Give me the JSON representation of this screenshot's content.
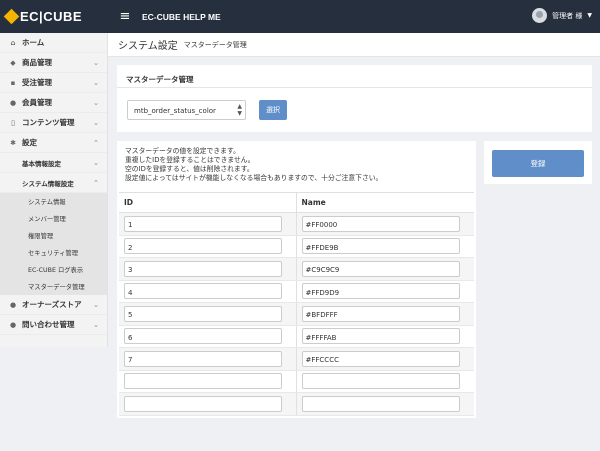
{
  "header": {
    "logo_text": "EC|CUBE",
    "site_title": "EC-CUBE HELP ME",
    "user_name": "管理者 様"
  },
  "sidebar": {
    "items": [
      {
        "label": "ホーム",
        "icon": "home-icon"
      },
      {
        "label": "商品管理",
        "icon": "tag-icon"
      },
      {
        "label": "受注管理",
        "icon": "cart-icon"
      },
      {
        "label": "会員管理",
        "icon": "users-icon"
      },
      {
        "label": "コンテンツ管理",
        "icon": "file-icon"
      },
      {
        "label": "設定",
        "icon": "gear-icon"
      }
    ],
    "settings_sub": [
      {
        "label": "基本情報設定"
      },
      {
        "label": "システム情報設定"
      }
    ],
    "system_sub": [
      "システム情報",
      "メンバー管理",
      "権限管理",
      "セキュリティ管理",
      "EC-CUBE ログ表示",
      "マスターデータ管理"
    ],
    "bottom_items": [
      {
        "label": "オーナーズストア",
        "icon": "info-icon"
      },
      {
        "label": "問い合わせ管理",
        "icon": "chat-icon"
      }
    ]
  },
  "breadcrumb": {
    "title": "システム設定",
    "sub": "マスターデータ管理"
  },
  "master_card": {
    "title": "マスターデータ管理",
    "select_value": "mtb_order_status_color",
    "select_button": "選択"
  },
  "data_card": {
    "description": [
      "マスターデータの値を設定できます。",
      "重複したIDを登録することはできません。",
      "空のIDを登録すると、値は削除されます。",
      "設定値によってはサイトが機能しなくなる場合もありますので、十分ご注意下さい。"
    ],
    "columns": {
      "id": "ID",
      "name": "Name"
    },
    "rows": [
      {
        "id": "1",
        "name": "#FF0000"
      },
      {
        "id": "2",
        "name": "#FFDE9B"
      },
      {
        "id": "3",
        "name": "#C9C9C9"
      },
      {
        "id": "4",
        "name": "#FFD9D9"
      },
      {
        "id": "5",
        "name": "#BFDFFF"
      },
      {
        "id": "6",
        "name": "#FFFFAB"
      },
      {
        "id": "7",
        "name": "#FFCCCC"
      },
      {
        "id": "",
        "name": ""
      },
      {
        "id": "",
        "name": ""
      }
    ]
  },
  "actions": {
    "register_label": "登録"
  },
  "colors": {
    "header_bg": "#262f3d",
    "accent": "#5f8ec9",
    "page_bg": "#eff0f4"
  }
}
